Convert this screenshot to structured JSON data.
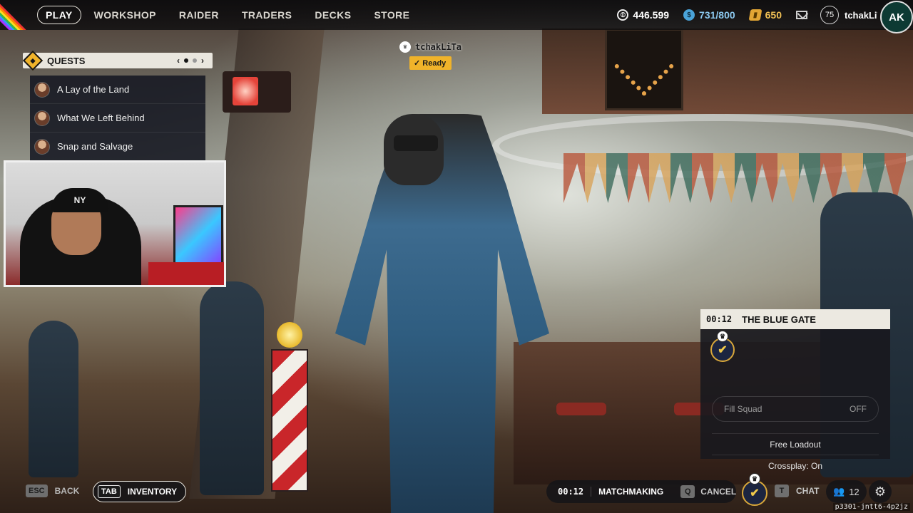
{
  "nav": {
    "items": [
      {
        "label": "PLAY",
        "active": true
      },
      {
        "label": "WORKSHOP",
        "active": false
      },
      {
        "label": "RAIDER",
        "active": false
      },
      {
        "label": "TRADERS",
        "active": false
      },
      {
        "label": "DECKS",
        "active": false
      },
      {
        "label": "STORE",
        "active": false
      }
    ]
  },
  "currencies": {
    "coins": {
      "value": "446.599",
      "icon": "coin-icon"
    },
    "bars": {
      "value": "731/800",
      "icon": "bar-currency-icon",
      "color": "#8cc9ef"
    },
    "gold": {
      "value": "650",
      "icon": "gold-currency-icon",
      "color": "#f1c155"
    }
  },
  "profile": {
    "level": "75",
    "username": "tchakLiTa",
    "logo_text": "AK"
  },
  "quests": {
    "title": "QUESTS",
    "pager_prev": "‹",
    "pager_next": "›",
    "items": [
      {
        "label": "A Lay of the Land"
      },
      {
        "label": "What We Left Behind"
      },
      {
        "label": "Snap and Salvage"
      }
    ]
  },
  "player_tag": {
    "name": "tchakLiTa",
    "status": "Ready"
  },
  "webcam": {
    "cap_text": "NY"
  },
  "squad_panel": {
    "timer": "00:12",
    "map_name": "THE BLUE GATE",
    "fill_squad_label": "Fill Squad",
    "fill_squad_value": "OFF",
    "loadout": "Free Loadout",
    "crossplay": "Crossplay: On"
  },
  "bottom_bar": {
    "back_key": "ESC",
    "back_label": "BACK",
    "inventory_key": "TAB",
    "inventory_label": "INVENTORY",
    "timer": "00:12",
    "status": "MATCHMAKING",
    "cancel_key": "Q",
    "cancel_label": "CANCEL",
    "chat_key": "T",
    "chat_label": "CHAT",
    "friends_count": "12"
  },
  "session_id": "p3301-jntt6-4p2jz",
  "colors": {
    "accent": "#f0b32a",
    "panel": "#ece9e1"
  }
}
